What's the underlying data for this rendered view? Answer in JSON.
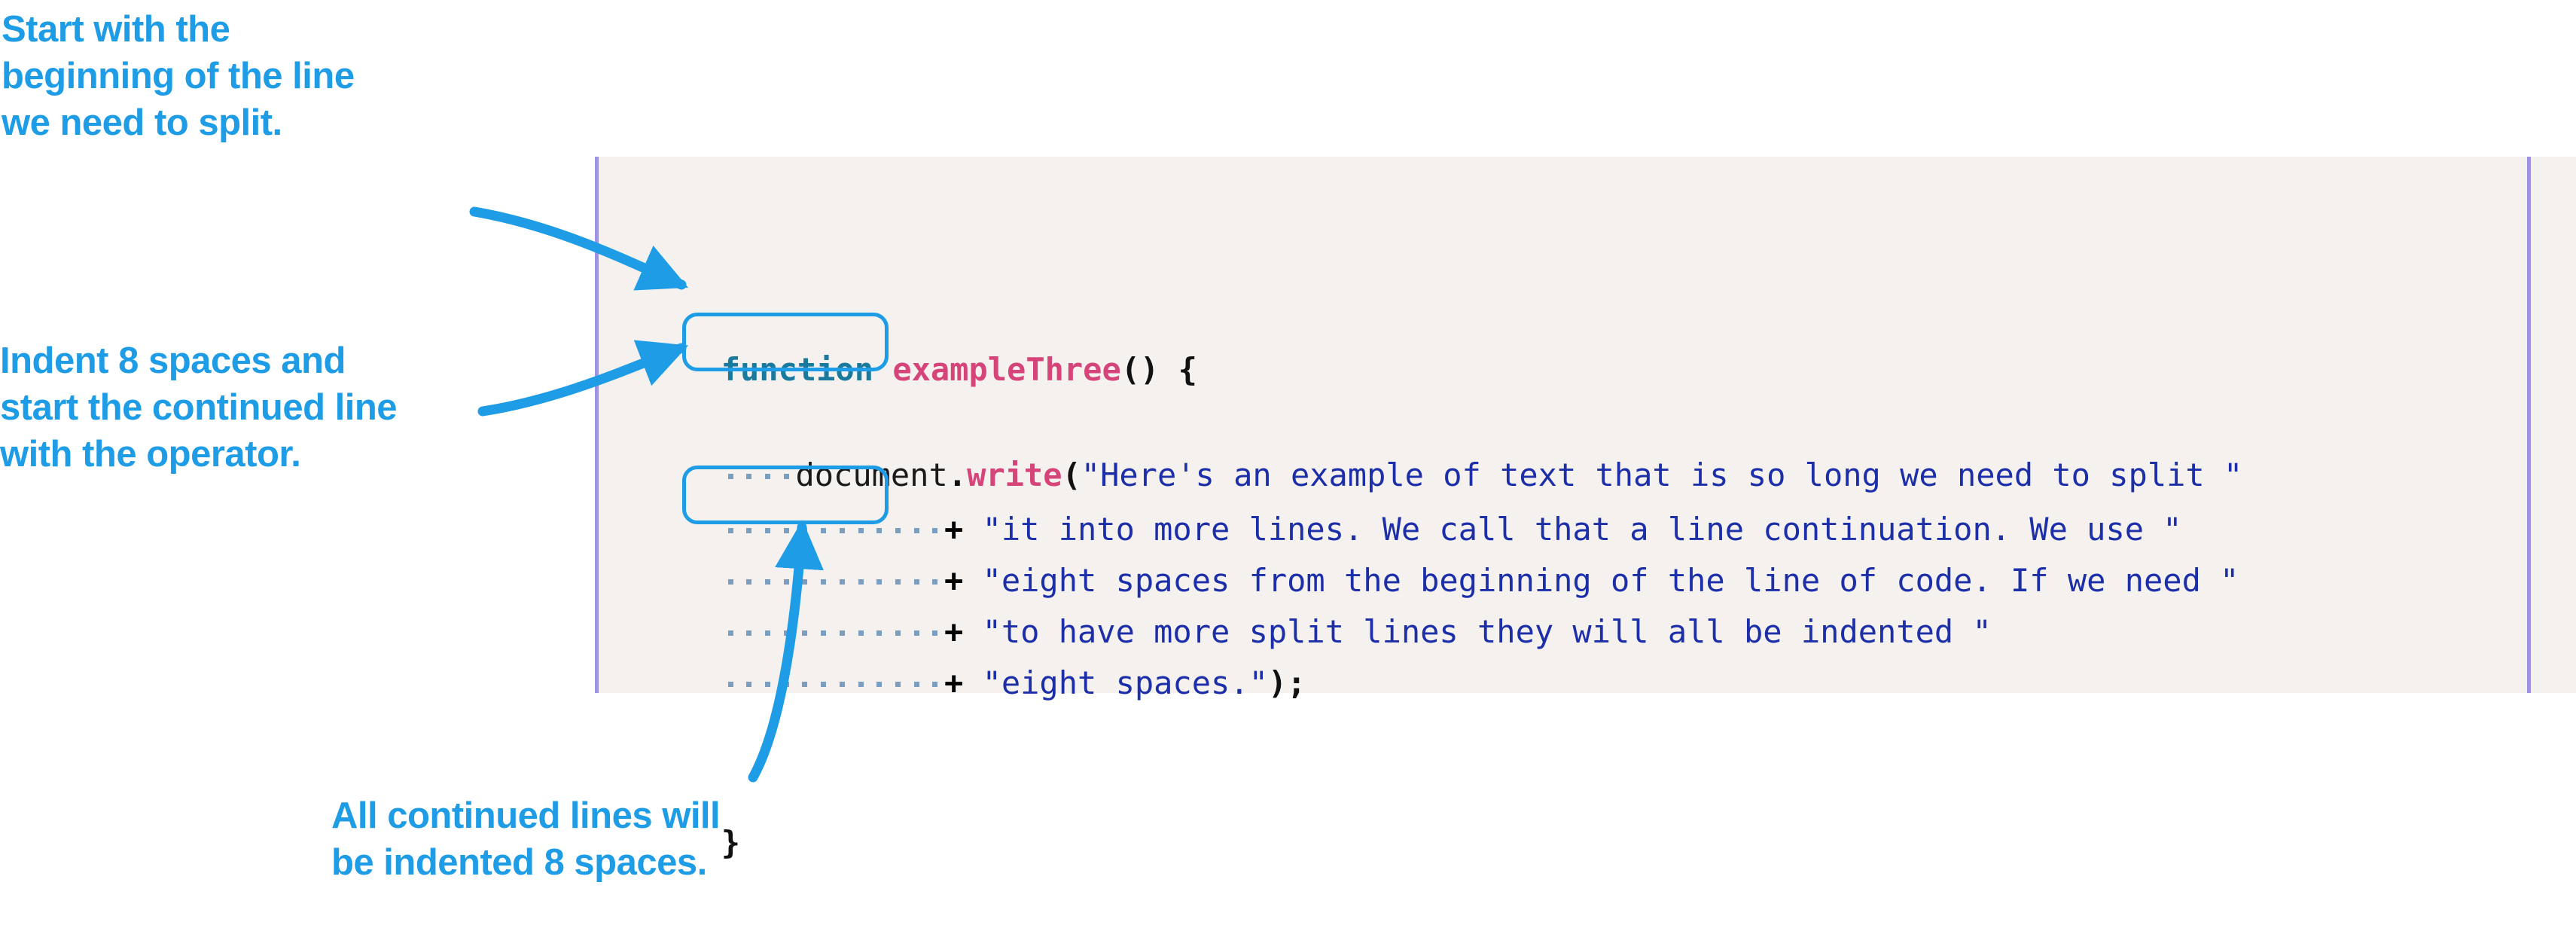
{
  "colors": {
    "annotation_blue": "#1e9ce6",
    "code_background": "#f4f1ee",
    "margin_rule_purple": "#9d93e0",
    "keyword_teal": "#1a7a9e",
    "function_name_pink": "#d6457a",
    "string_blue": "#1c2fa8",
    "space_dot": "#7d9dc0",
    "page_background": "#ffffff"
  },
  "annotations": {
    "top": "Start with the\nbeginning of the line\nwe need to split.",
    "middle": "Indent 8 spaces and\nstart the continued line\nwith the operator.",
    "bottom": "All continued lines will\nbe indented 8 spaces."
  },
  "code": {
    "language": "javascript",
    "indent_marker": "·",
    "lines": [
      {
        "index": 1,
        "text": "function exampleThree() {",
        "leading_spaces": 0,
        "tokens": [
          {
            "kind": "keyword",
            "text": "function"
          },
          {
            "kind": "plain",
            "text": " "
          },
          {
            "kind": "function",
            "text": "exampleThree"
          },
          {
            "kind": "punct",
            "text": "() {"
          }
        ]
      },
      {
        "index": 2,
        "text": "    document.write(\"Here's an example of text that is so long we need to split \"",
        "leading_spaces": 4,
        "highlight": false,
        "tokens": [
          {
            "kind": "ident",
            "text": "document"
          },
          {
            "kind": "punct",
            "text": "."
          },
          {
            "kind": "method",
            "text": "write"
          },
          {
            "kind": "punct",
            "text": "("
          },
          {
            "kind": "string",
            "text": "\"Here's an example of text that is so long we need to split \""
          }
        ]
      },
      {
        "index": 3,
        "text": "            + \"it into more lines. We call that a line continuation. We use \"",
        "leading_spaces": 12,
        "highlight": true,
        "tokens": [
          {
            "kind": "operator",
            "text": "+"
          },
          {
            "kind": "plain",
            "text": " "
          },
          {
            "kind": "string",
            "text": "\"it into more lines. We call that a line continuation. We use \""
          }
        ]
      },
      {
        "index": 4,
        "text": "            + \"eight spaces from the beginning of the line of code. If we need \"",
        "leading_spaces": 12,
        "highlight": false,
        "tokens": [
          {
            "kind": "operator",
            "text": "+"
          },
          {
            "kind": "plain",
            "text": " "
          },
          {
            "kind": "string",
            "text": "\"eight spaces from the beginning of the line of code. If we need \""
          }
        ]
      },
      {
        "index": 5,
        "text": "            + \"to have more split lines they will all be indented \"",
        "leading_spaces": 12,
        "highlight": false,
        "tokens": [
          {
            "kind": "operator",
            "text": "+"
          },
          {
            "kind": "plain",
            "text": " "
          },
          {
            "kind": "string",
            "text": "\"to have more split lines they will all be indented \""
          }
        ]
      },
      {
        "index": 6,
        "text": "            + \"eight spaces.\");",
        "leading_spaces": 12,
        "highlight": true,
        "tokens": [
          {
            "kind": "operator",
            "text": "+"
          },
          {
            "kind": "plain",
            "text": " "
          },
          {
            "kind": "string",
            "text": "\"eight spaces.\""
          },
          {
            "kind": "punct",
            "text": ");"
          }
        ]
      },
      {
        "index": 7,
        "text": "}",
        "leading_spaces": 0,
        "tokens": [
          {
            "kind": "punct",
            "text": "}"
          }
        ]
      }
    ]
  }
}
